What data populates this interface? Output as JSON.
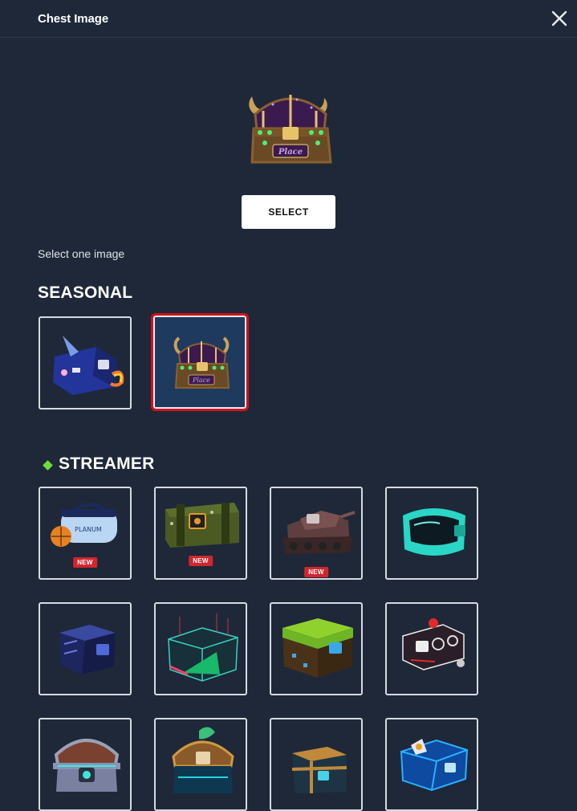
{
  "header": {
    "title": "Chest Image",
    "close_icon": "close-icon"
  },
  "preview": {
    "icon": "purple-gold-treasure-chest-icon"
  },
  "select_button": {
    "label": "SELECT"
  },
  "hint": "Select one image",
  "sections": {
    "seasonal": {
      "title": "SEASONAL"
    },
    "streamer": {
      "title": "STREAMER",
      "accent_color": "#6fdb3a"
    }
  },
  "badges": {
    "new": "NEW"
  },
  "colors": {
    "background": "#1e2838",
    "selected_outline": "#d0121c",
    "selected_fill": "#1f3a5f",
    "badge": "#d0262f"
  }
}
